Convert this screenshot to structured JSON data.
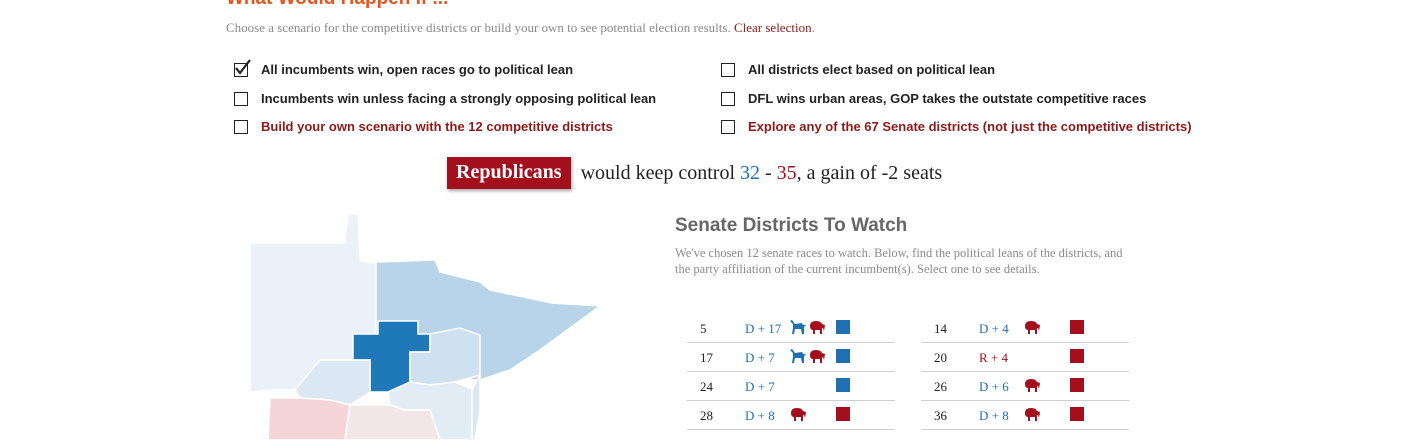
{
  "header": {
    "title": "What Would Happen If ...",
    "intro": "Choose a scenario for the competitive districts or build your own to see potential election results.",
    "clear_link": "Clear selection",
    "intro_end": "."
  },
  "scenarios": [
    {
      "label": "All incumbents win, open races go to political lean",
      "checked": true,
      "style": "normal"
    },
    {
      "label": "All districts elect based on political lean",
      "checked": false,
      "style": "normal"
    },
    {
      "label": "Incumbents win unless facing a strongly opposing political lean",
      "checked": false,
      "style": "normal"
    },
    {
      "label": "DFL wins urban areas, GOP takes the outstate competitive races",
      "checked": false,
      "style": "normal"
    },
    {
      "label": "Build your own scenario with the 12 competitive districts",
      "checked": false,
      "style": "link"
    },
    {
      "label": "Explore any of the 67 Senate districts (not just the competitive districts)",
      "checked": false,
      "style": "link"
    }
  ],
  "result": {
    "party": "Republicans",
    "text1": "would keep control",
    "dem_seats": "32",
    "dash": "-",
    "gop_seats": "35",
    "text2": ", a gain of -2 seats"
  },
  "watch": {
    "title": "Senate Districts To Watch",
    "description": "We've chosen 12 senate races to watch. Below, find the political leans of the districts, and the party affiliation of the current incumbent(s). Select one to see details."
  },
  "colors": {
    "dem": "#1f6fb2",
    "gop": "#a30f1c",
    "accent": "#e5561c"
  },
  "districts_left": [
    {
      "num": "5",
      "lean": "D + 17",
      "lean_party": "D",
      "incumbents": [
        "donkey-icon",
        "elephant-icon"
      ],
      "result": "D"
    },
    {
      "num": "17",
      "lean": "D + 7",
      "lean_party": "D",
      "incumbents": [
        "donkey-icon",
        "elephant-icon"
      ],
      "result": "D"
    },
    {
      "num": "24",
      "lean": "D + 7",
      "lean_party": "D",
      "incumbents": [],
      "result": "D"
    },
    {
      "num": "28",
      "lean": "D + 8",
      "lean_party": "D",
      "incumbents": [
        "elephant-icon"
      ],
      "result": "R"
    }
  ],
  "districts_right": [
    {
      "num": "14",
      "lean": "D + 4",
      "lean_party": "D",
      "incumbents": [
        "elephant-icon"
      ],
      "result": "R"
    },
    {
      "num": "20",
      "lean": "R + 4",
      "lean_party": "R",
      "incumbents": [],
      "result": "R"
    },
    {
      "num": "26",
      "lean": "D + 6",
      "lean_party": "D",
      "incumbents": [
        "elephant-icon"
      ],
      "result": "R"
    },
    {
      "num": "36",
      "lean": "D + 8",
      "lean_party": "D",
      "incumbents": [
        "elephant-icon"
      ],
      "result": "R"
    }
  ]
}
